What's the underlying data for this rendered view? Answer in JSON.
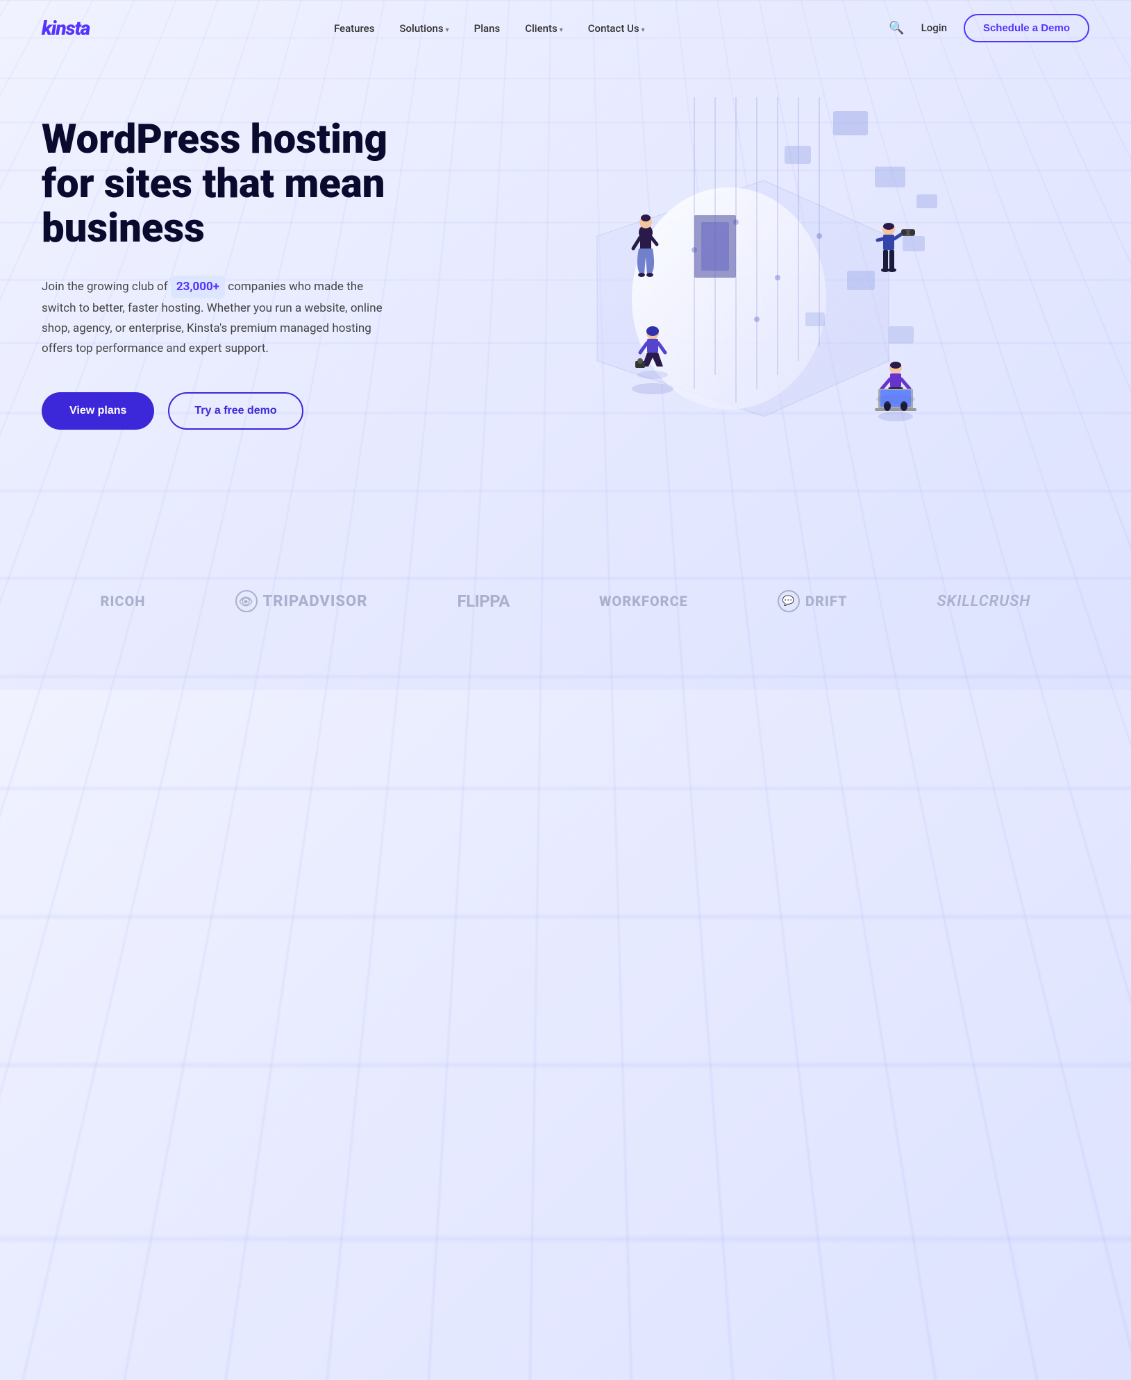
{
  "brand": {
    "name": "kinsta"
  },
  "nav": {
    "links": [
      {
        "label": "Features",
        "has_dropdown": false
      },
      {
        "label": "Solutions",
        "has_dropdown": true
      },
      {
        "label": "Plans",
        "has_dropdown": false
      },
      {
        "label": "Clients",
        "has_dropdown": true
      },
      {
        "label": "Contact Us",
        "has_dropdown": true
      }
    ],
    "login_label": "Login",
    "schedule_label": "Schedule a Demo"
  },
  "hero": {
    "title": "WordPress hosting for sites that mean business",
    "highlight": "23,000+",
    "description_before": "Join the growing club of",
    "description_after": "companies who made the switch to better, faster hosting. Whether you run a website, online shop, agency, or enterprise, Kinsta's premium managed hosting offers top performance and expert support.",
    "btn_primary": "View plans",
    "btn_secondary": "Try a free demo"
  },
  "clients": [
    {
      "name": "RICOH",
      "type": "text"
    },
    {
      "name": "Tripadvisor",
      "type": "logo-text"
    },
    {
      "name": "Flippa",
      "type": "text"
    },
    {
      "name": "Workforce",
      "type": "text"
    },
    {
      "name": "Drift",
      "type": "logo-text"
    },
    {
      "name": "skillcrush",
      "type": "italic"
    }
  ]
}
